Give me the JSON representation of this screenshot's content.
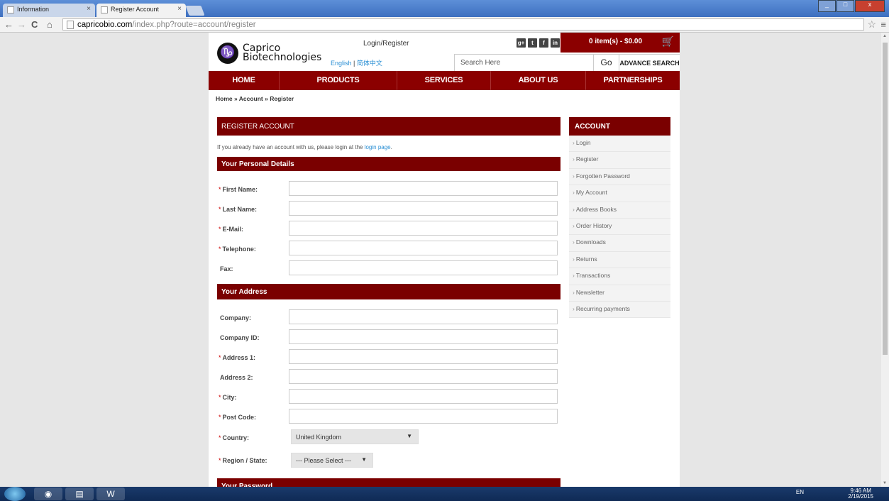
{
  "browser": {
    "tabs": [
      {
        "title": "Information"
      },
      {
        "title": "Register Account"
      }
    ],
    "url_host": "capricobio.com",
    "url_path": "/index.php?route=account/register",
    "nav": {
      "back": "←",
      "forward": "→",
      "reload": "C",
      "home": "⌂"
    }
  },
  "header": {
    "logo_line1": "Caprico",
    "logo_line2": "Biotechnologies",
    "logo_glyph": "♑",
    "login_register": "Login/Register",
    "lang_english": "English",
    "lang_sep": "|",
    "lang_chinese": "简体中文",
    "social": [
      "g+",
      "t",
      "f",
      "in"
    ],
    "cart_text": "0 item(s) - $0.00",
    "search_placeholder": "Search Here",
    "go_label": "Go",
    "advance_search": "ADVANCE SEARCH"
  },
  "mainnav": [
    "HOME",
    "PRODUCTS",
    "SERVICES",
    "ABOUT US",
    "PARTNERSHIPS"
  ],
  "breadcrumb": "Home » Account » Register",
  "content": {
    "register_title": "REGISTER ACCOUNT",
    "intro_text": "If you already have an account with us, please login at the ",
    "intro_link": "login page",
    "intro_end": ".",
    "personal_title": "Your Personal Details",
    "personal_fields": [
      {
        "label": "First Name:",
        "required": "*"
      },
      {
        "label": "Last Name:",
        "required": "*"
      },
      {
        "label": "E-Mail:",
        "required": "*"
      },
      {
        "label": "Telephone:",
        "required": "*"
      },
      {
        "label": "Fax:",
        "required": ""
      }
    ],
    "address_title": "Your Address",
    "address_fields": [
      {
        "label": "Company:",
        "required": ""
      },
      {
        "label": "Company ID:",
        "required": ""
      },
      {
        "label": "Address 1:",
        "required": "*"
      },
      {
        "label": "Address 2:",
        "required": ""
      },
      {
        "label": "City:",
        "required": "*"
      },
      {
        "label": "Post Code:",
        "required": "*"
      }
    ],
    "country_label": "Country:",
    "country_required": "*",
    "country_value": "United Kingdom",
    "region_label": "Region / State:",
    "region_required": "*",
    "region_value": "--- Please Select ---",
    "password_title": "Your Password"
  },
  "sidebar": {
    "title": "ACCOUNT",
    "items": [
      "Login",
      "Register",
      "Forgotten Password",
      "My Account",
      "Address Books",
      "Order History",
      "Downloads",
      "Returns",
      "Transactions",
      "Newsletter",
      "Recurring payments"
    ]
  },
  "taskbar": {
    "tray_text": "EN",
    "time": "9:46 AM",
    "date": "2/19/2015"
  },
  "colors": {
    "brand": "#8b0000",
    "link": "#2a8fd4"
  }
}
